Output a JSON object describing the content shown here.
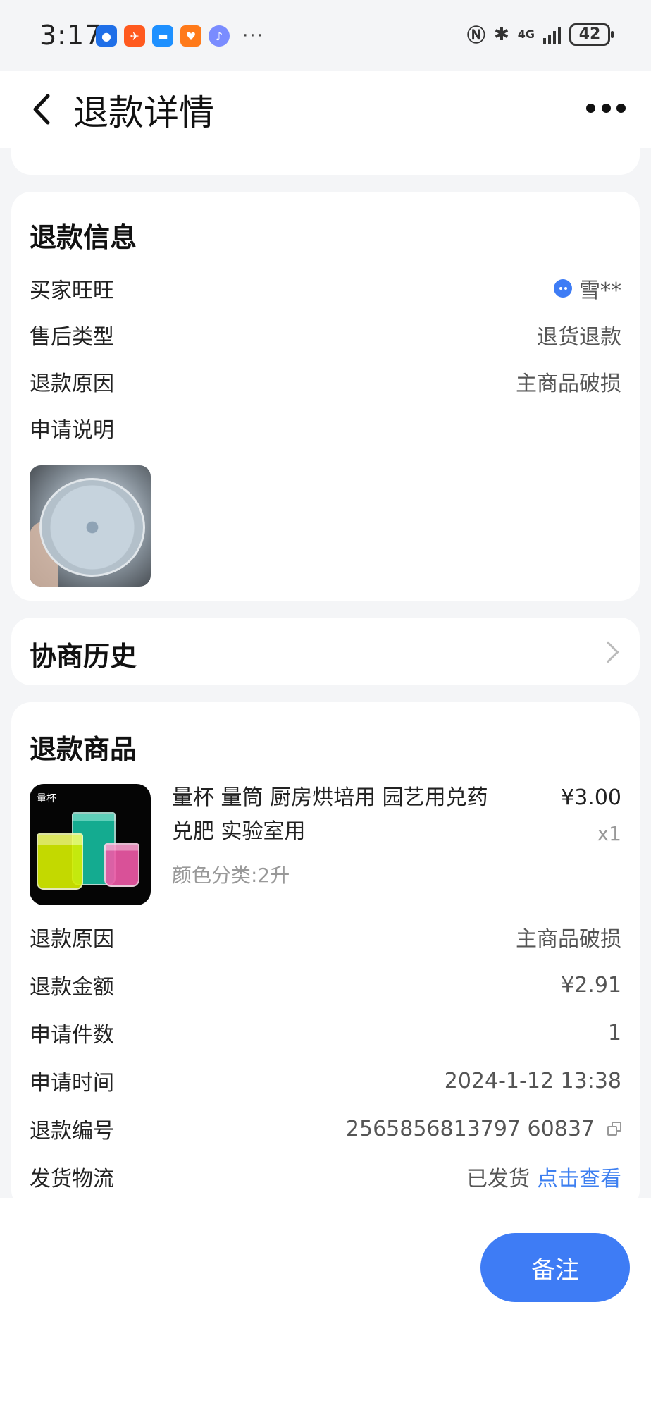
{
  "status_bar": {
    "time": "3:17",
    "overflow": "···",
    "network": "4G",
    "battery": "42"
  },
  "nav": {
    "title": "退款详情"
  },
  "refund_info": {
    "title": "退款信息",
    "rows": [
      {
        "label": "买家旺旺",
        "value": "雪**"
      },
      {
        "label": "售后类型",
        "value": "退货退款"
      },
      {
        "label": "退款原因",
        "value": "主商品破损"
      },
      {
        "label": "申请说明",
        "value": ""
      }
    ]
  },
  "history": {
    "title": "协商历史"
  },
  "refund_goods": {
    "title": "退款商品",
    "product": {
      "image_tag": "量杯",
      "name": "量杯 量筒 厨房烘培用  园艺用兑药兑肥  实验室用",
      "spec": "颜色分类:2升",
      "price": "¥3.00",
      "qty": "x1"
    },
    "rows": [
      {
        "label": "退款原因",
        "value": "主商品破损"
      },
      {
        "label": "退款金额",
        "value": "¥2.91"
      },
      {
        "label": "申请件数",
        "value": "1"
      },
      {
        "label": "申请时间",
        "value": "2024-1-12 13:38"
      },
      {
        "label": "退款编号",
        "value": "2565856813797 60837"
      },
      {
        "label": "发货物流",
        "value": "已发货",
        "link": "点击查看"
      }
    ]
  },
  "actions": {
    "note_button": "备注"
  },
  "colors": {
    "accent": "#3e7cf5",
    "background": "#f4f5f7"
  }
}
